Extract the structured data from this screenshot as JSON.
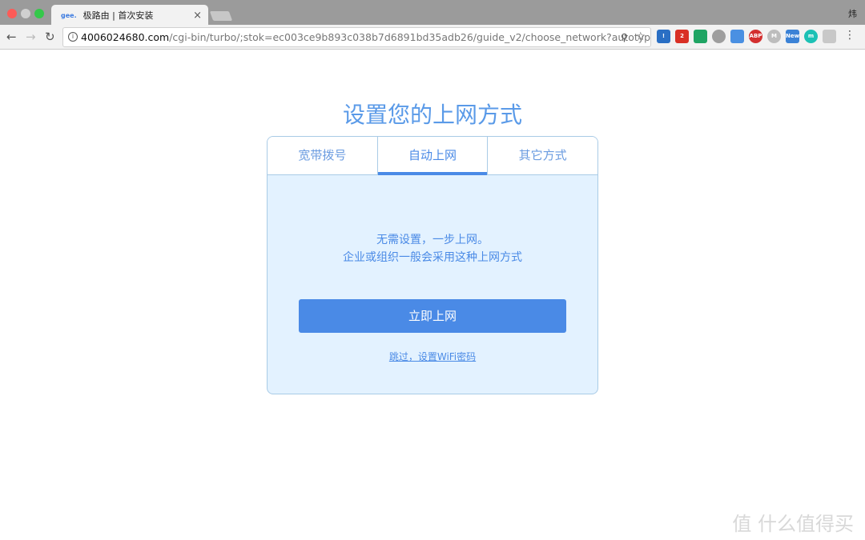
{
  "browser": {
    "tab_title": "极路由 | 首次安装",
    "tab_logo": "gee.",
    "user": "炜",
    "url_host": "4006024680.com",
    "url_path": "/cgi-bin/turbo/;stok=ec003ce9b893c038b7d6891bd35adb26/guide_v2/choose_network?autotype...",
    "extensions": [
      {
        "icon": "outlook-icon",
        "color": "#2a6fc4",
        "text": "!"
      },
      {
        "icon": "gmail-icon",
        "color": "#d93025",
        "text": "2"
      },
      {
        "icon": "drive-icon",
        "color": "#1fa463",
        "text": ""
      },
      {
        "icon": "green-dot-icon",
        "color": "#9e9e9e",
        "text": ""
      },
      {
        "icon": "bookmark-icon",
        "color": "#4a90e2",
        "text": ""
      },
      {
        "icon": "adblock-icon",
        "color": "#d32f2f",
        "text": "ABP"
      },
      {
        "icon": "m-icon",
        "color": "#bdbdbd",
        "text": "M"
      },
      {
        "icon": "news-icon",
        "color": "#3b82d6",
        "text": "New"
      },
      {
        "icon": "teal-m-icon",
        "color": "#1cc1b5",
        "text": "m"
      },
      {
        "icon": "bird-icon",
        "color": "#c8c8c8",
        "text": ""
      }
    ]
  },
  "page": {
    "title": "设置您的上网方式",
    "tabs": [
      {
        "label": "宽带拨号"
      },
      {
        "label": "自动上网"
      },
      {
        "label": "其它方式"
      }
    ],
    "desc_line1": "无需设置，一步上网。",
    "desc_line2": "企业或组织一般会采用这种上网方式",
    "connect_button": "立即上网",
    "skip_link": "跳过，设置WiFi密码"
  },
  "watermark": "值 什么值得买"
}
